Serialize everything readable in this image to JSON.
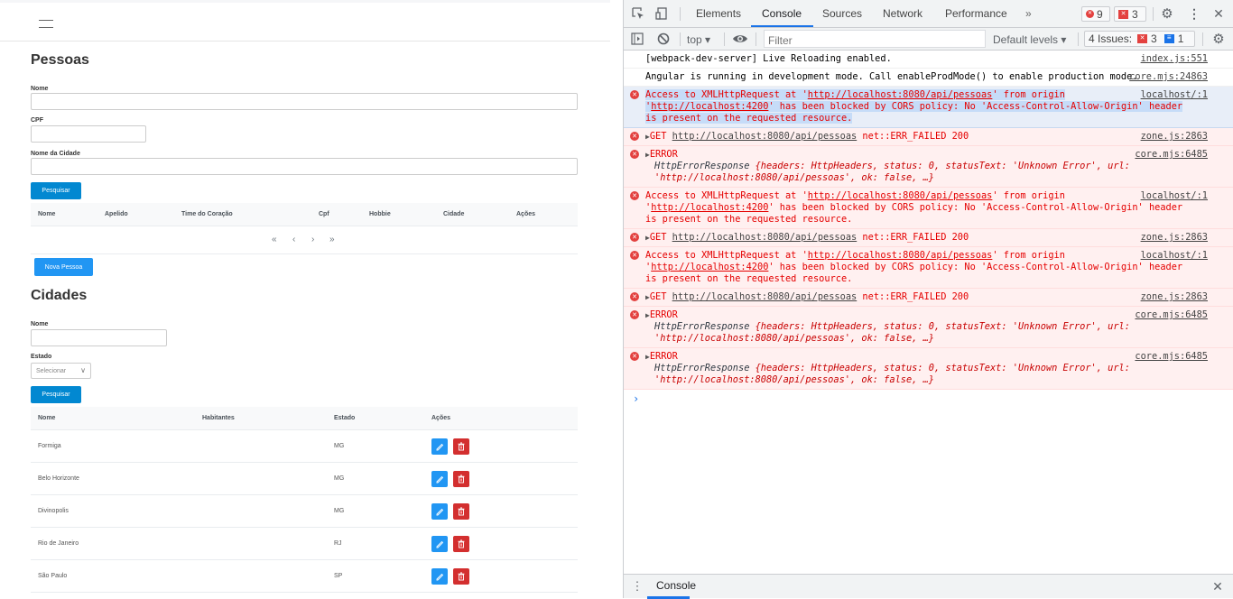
{
  "app": {
    "pessoas": {
      "title": "Pessoas",
      "fields": {
        "nome_label": "Nome",
        "nome_value": "",
        "cpf_label": "CPF",
        "cpf_value": "",
        "cidade_label": "Nome da Cidade",
        "cidade_value": ""
      },
      "search_button": "Pesquisar",
      "table_headers": [
        "Nome",
        "Apelido",
        "Time do Coração",
        "Cpf",
        "Hobbie",
        "Cidade",
        "Ações"
      ],
      "pager": {
        "first": "«",
        "prev": "‹",
        "next": "›",
        "last": "»"
      },
      "new_button": "Nova Pessoa"
    },
    "cidades": {
      "title": "Cidades",
      "nome_label": "Nome",
      "nome_value": "",
      "estado_label": "Estado",
      "estado_selected": "Selecionar",
      "search_button": "Pesquisar",
      "table_headers": [
        "Nome",
        "Habitantes",
        "Estado",
        "Ações"
      ],
      "rows": [
        {
          "nome": "Formiga",
          "habitantes": "",
          "estado": "MG"
        },
        {
          "nome": "Belo Horizonte",
          "habitantes": "",
          "estado": "MG"
        },
        {
          "nome": "Divinopolis",
          "habitantes": "",
          "estado": "MG"
        },
        {
          "nome": "Rio de Janeiro",
          "habitantes": "",
          "estado": "RJ"
        },
        {
          "nome": "São Paulo",
          "habitantes": "",
          "estado": "SP"
        }
      ]
    }
  },
  "devtools": {
    "tabs": [
      "Elements",
      "Console",
      "Sources",
      "Network",
      "Performance"
    ],
    "active_tab": "Console",
    "more_tabs": "»",
    "error_count": "9",
    "issue_count_top": "3",
    "context": "top ▾",
    "filter_placeholder": "Filter",
    "levels": "Default levels ▾",
    "issues_label": "4 Issues:",
    "issues_errors": "3",
    "issues_info": "1",
    "messages": [
      {
        "type": "log",
        "text": "[webpack-dev-server] Live Reloading enabled.",
        "source": "index.js:551"
      },
      {
        "type": "log",
        "text": "Angular is running in development mode. Call enableProdMode() to enable production mode.",
        "source": "core.mjs:24863"
      },
      {
        "type": "cors",
        "selected": true,
        "pre": "Access to XMLHttpRequest at '",
        "url": "http://localhost:8080/api/pessoas",
        "mid": "' from origin '",
        "origin": "http://localhost:4200",
        "post": "' has been blocked by CORS policy: No 'Access-Control-Allow-Origin' header is present on the requested resource.",
        "source": "localhost/:1"
      },
      {
        "type": "get",
        "method": "GET",
        "url": "http://localhost:8080/api/pessoas",
        "status": "net::ERR_FAILED 200",
        "source": "zone.js:2863"
      },
      {
        "type": "error",
        "label": "ERROR",
        "obj_name": "HttpErrorResponse",
        "obj": "{headers: HttpHeaders, status: 0, statusText: 'Unknown Error', url: 'http://localhost:8080/api/pessoas', ok: false, …}",
        "source": "core.mjs:6485"
      },
      {
        "type": "cors",
        "selected": false,
        "pre": "Access to XMLHttpRequest at '",
        "url": "http://localhost:8080/api/pessoas",
        "mid": "' from origin '",
        "origin": "http://localhost:4200",
        "post": "' has been blocked by CORS policy: No 'Access-Control-Allow-Origin' header is present on the requested resource.",
        "source": "localhost/:1"
      },
      {
        "type": "get",
        "method": "GET",
        "url": "http://localhost:8080/api/pessoas",
        "status": "net::ERR_FAILED 200",
        "source": "zone.js:2863"
      },
      {
        "type": "cors",
        "selected": false,
        "pre": "Access to XMLHttpRequest at '",
        "url": "http://localhost:8080/api/pessoas",
        "mid": "' from origin '",
        "origin": "http://localhost:4200",
        "post": "' has been blocked by CORS policy: No 'Access-Control-Allow-Origin' header is present on the requested resource.",
        "source": "localhost/:1"
      },
      {
        "type": "get",
        "method": "GET",
        "url": "http://localhost:8080/api/pessoas",
        "status": "net::ERR_FAILED 200",
        "source": "zone.js:2863"
      },
      {
        "type": "error",
        "label": "ERROR",
        "obj_name": "HttpErrorResponse",
        "obj": "{headers: HttpHeaders, status: 0, statusText: 'Unknown Error', url: 'http://localhost:8080/api/pessoas', ok: false, …}",
        "source": "core.mjs:6485"
      },
      {
        "type": "error",
        "label": "ERROR",
        "obj_name": "HttpErrorResponse",
        "obj": "{headers: HttpHeaders, status: 0, statusText: 'Unknown Error', url: 'http://localhost:8080/api/pessoas', ok: false, …}",
        "source": "core.mjs:6485"
      }
    ],
    "prompt": "›",
    "drawer_tab": "Console"
  }
}
